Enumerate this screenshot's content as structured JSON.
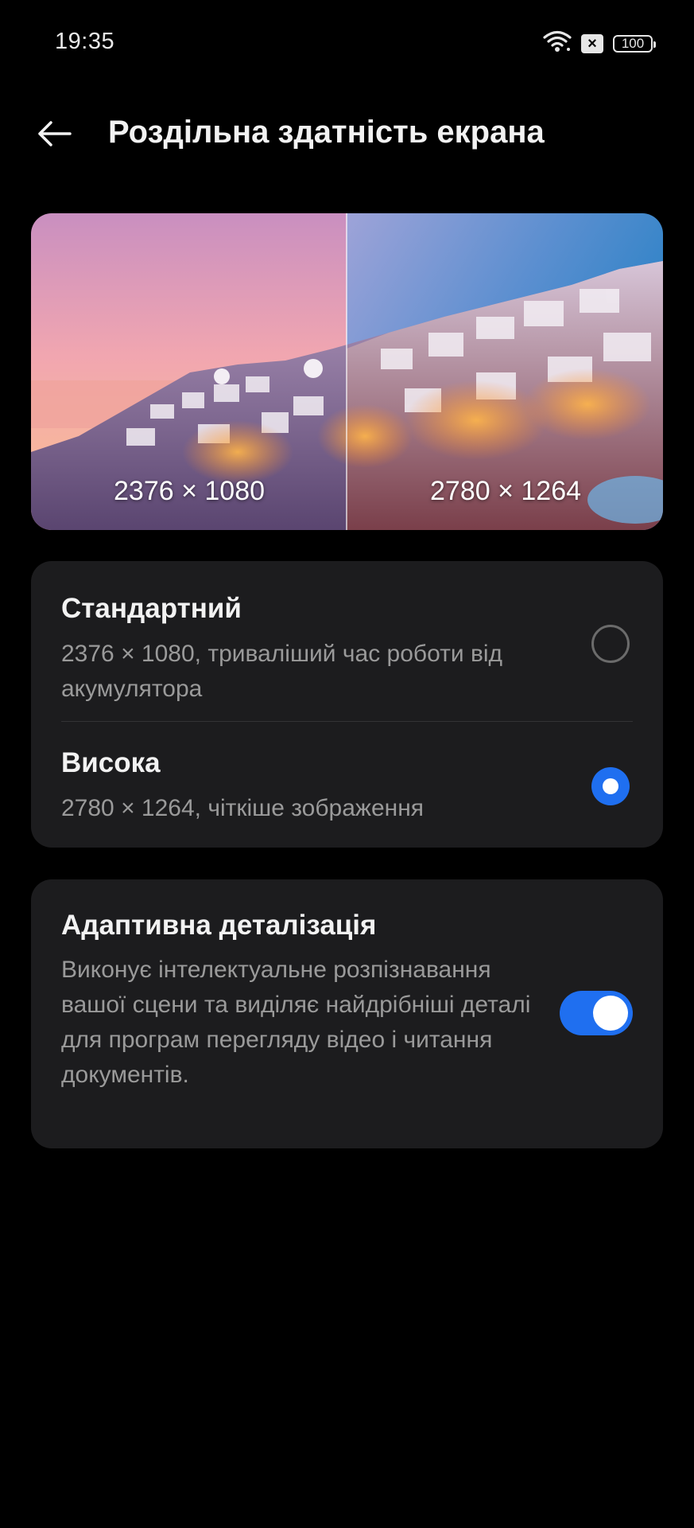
{
  "status_bar": {
    "time": "19:35",
    "battery_level": "100",
    "icons": [
      "wifi-icon",
      "sim-blocked-icon",
      "battery-icon"
    ]
  },
  "header": {
    "back_icon": "arrow-left-icon",
    "title": "Роздільна здатність екрана"
  },
  "preview": {
    "left_label": "2376 × 1080",
    "right_label": "2780 × 1264"
  },
  "resolution_options": [
    {
      "title": "Стандартний",
      "description": "2376 × 1080, триваліший час роботи від акумулятора",
      "selected": false
    },
    {
      "title": "Висока",
      "description": "2780 × 1264, чіткіше зображення",
      "selected": true
    }
  ],
  "adaptive": {
    "title": "Адаптивна деталізація",
    "description": "Виконує інтелектуальне розпізнавання вашої сцени та виділяє найдрібніші деталі для програм перегляду відео і читання документів.",
    "enabled": true
  },
  "colors": {
    "accent": "#1f6ff0",
    "card_bg": "#1c1c1e",
    "background": "#000000"
  }
}
